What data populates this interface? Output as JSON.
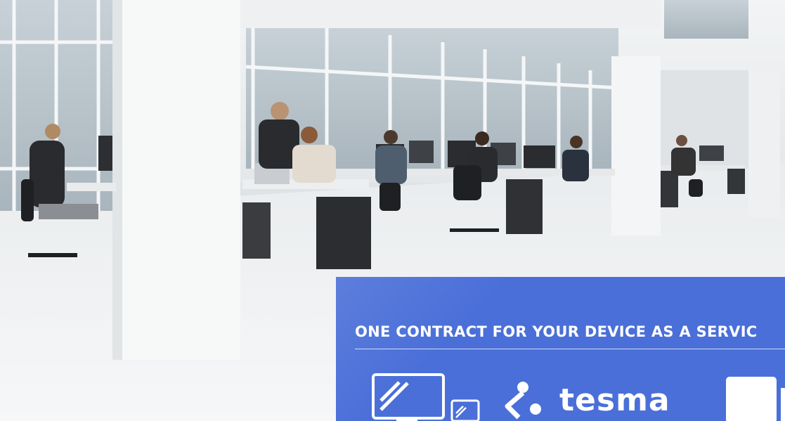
{
  "scene": {
    "description_icon": "office-photo"
  },
  "promo": {
    "title": "ONE CONTRACT FOR YOUR DEVICE AS A SERVIC",
    "brand": "tesma",
    "colors": {
      "card": "#4a6fd8",
      "text": "#ffffff"
    },
    "icons": [
      "monitor-icon",
      "tablet-icon",
      "share-icon",
      "phone-icon"
    ]
  }
}
